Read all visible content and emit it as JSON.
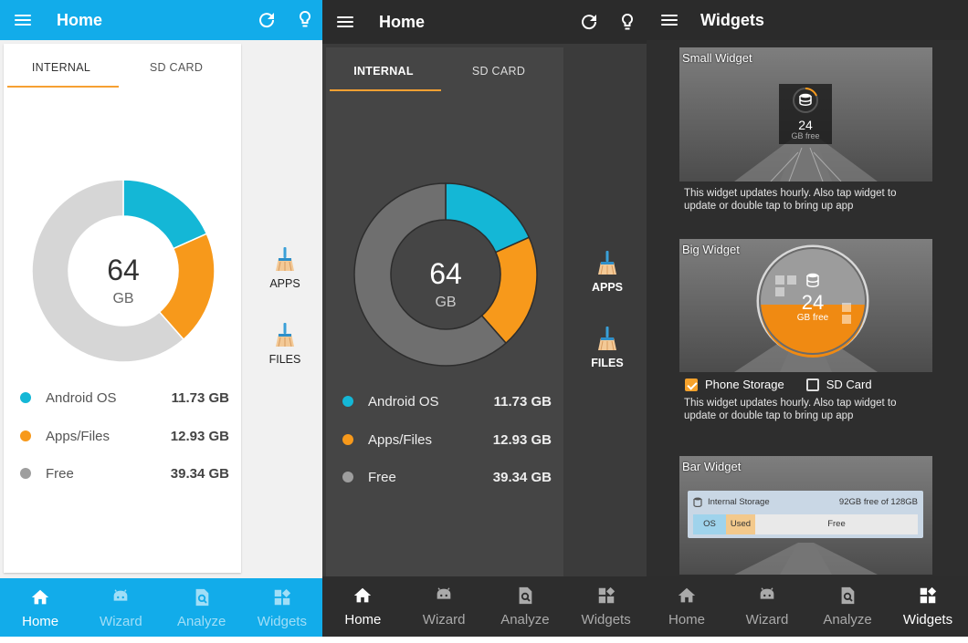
{
  "screens": [
    {
      "theme": "light",
      "title": "Home",
      "tabs": [
        "INTERNAL",
        "SD CARD"
      ],
      "total": "64",
      "unit": "GB",
      "legend": [
        {
          "label": "Android OS",
          "value": "11.73 GB",
          "color": "#14b7d6"
        },
        {
          "label": "Apps/Files",
          "value": "12.93 GB",
          "color": "#f7991b"
        },
        {
          "label": "Free",
          "value": "39.34 GB",
          "color": "#9e9e9e"
        }
      ],
      "actions": [
        "APPS",
        "FILES"
      ],
      "nav": [
        "Home",
        "Wizard",
        "Analyze",
        "Widgets"
      ]
    },
    {
      "theme": "dark",
      "title": "Home",
      "tabs": [
        "INTERNAL",
        "SD CARD"
      ],
      "total": "64",
      "unit": "GB",
      "legend": [
        {
          "label": "Android OS",
          "value": "11.73 GB",
          "color": "#14b7d6"
        },
        {
          "label": "Apps/Files",
          "value": "12.93 GB",
          "color": "#f7991b"
        },
        {
          "label": "Free",
          "value": "39.34 GB",
          "color": "#9e9e9e"
        }
      ],
      "actions": [
        "APPS",
        "FILES"
      ],
      "nav": [
        "Home",
        "Wizard",
        "Analyze",
        "Widgets"
      ]
    },
    {
      "theme": "dark",
      "title": "Widgets",
      "widgets": {
        "small": {
          "title": "Small Widget",
          "free_num": "24",
          "free_label": "GB free",
          "desc": "This widget updates hourly. Also tap widget to update or double tap to bring up app"
        },
        "big": {
          "title": "Big Widget",
          "free_num": "24",
          "free_label": "GB free",
          "desc": "This widget updates hourly. Also tap widget to update or double tap to bring up app",
          "options": [
            {
              "label": "Phone Storage",
              "checked": true
            },
            {
              "label": "SD Card",
              "checked": false
            }
          ]
        },
        "bar": {
          "title": "Bar Widget",
          "storage_label": "Internal Storage",
          "capacity": "92GB free of 128GB",
          "segments": [
            "OS",
            "Used",
            "Free"
          ]
        }
      },
      "nav": [
        "Home",
        "Wizard",
        "Analyze",
        "Widgets"
      ]
    }
  ],
  "colors": {
    "accent_blue": "#12acea",
    "android_os": "#14b7d6",
    "apps_files": "#f7991b",
    "free_light": "#d6d6d6",
    "free_dark": "#6f6f6f",
    "tab_indicator": "#f6a032"
  },
  "chart_data": [
    {
      "type": "pie",
      "categories": [
        "Android OS",
        "Apps/Files",
        "Free"
      ],
      "values": [
        11.73,
        12.93,
        39.34
      ],
      "title": "64 GB"
    },
    {
      "type": "pie",
      "categories": [
        "Android OS",
        "Apps/Files",
        "Free"
      ],
      "values": [
        11.73,
        12.93,
        39.34
      ],
      "title": "64 GB"
    }
  ],
  "icons": [
    "menu-icon",
    "refresh-icon",
    "lightbulb-icon",
    "broom-icon",
    "home-icon",
    "android-icon",
    "analyze-icon",
    "widgets-icon",
    "database-icon"
  ]
}
